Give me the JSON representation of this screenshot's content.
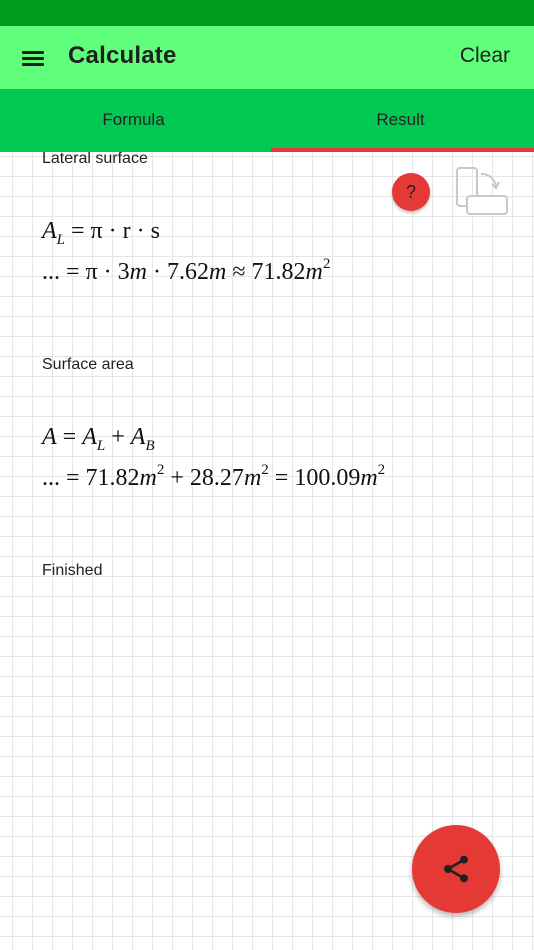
{
  "app_bar": {
    "title": "Calculate",
    "clear_label": "Clear",
    "menu_icon": "hamburger-menu-icon"
  },
  "tabs": [
    {
      "label": "Formula",
      "active": false
    },
    {
      "label": "Result",
      "active": true
    }
  ],
  "colors": {
    "status_bar": "#009a1f",
    "app_bar": "#5fff7b",
    "tab_bar": "#00c853",
    "accent": "#e53935"
  },
  "sections": {
    "lateral": {
      "label": "Lateral surface",
      "eq1": {
        "lhs": "A",
        "lhs_sub": "L",
        "rhs": "= π · r · s"
      },
      "eq2": {
        "prefix": "... = π · 3",
        "u1": "m",
        "mid1": " · 7.62",
        "u2": "m",
        "approx": " ≈ 71.82",
        "u3": "m",
        "exp": "2"
      }
    },
    "surface": {
      "label": "Surface area",
      "eq1": {
        "lhs": "A",
        "eq": " = ",
        "t1": "A",
        "t1_sub": "L",
        "plus": " + ",
        "t2": "A",
        "t2_sub": "B"
      },
      "eq2": {
        "prefix": "... = 71.82",
        "u1": "m",
        "e1": "2",
        "plus": " + 28.27",
        "u2": "m",
        "e2": "2",
        "eq": " = 100.09",
        "u3": "m",
        "e3": "2"
      }
    },
    "finished_label": "Finished"
  },
  "help_button": {
    "label": "?",
    "icon": "question-icon"
  },
  "rotate_icon": "rotate-screen-icon",
  "share_fab_icon": "share-icon"
}
